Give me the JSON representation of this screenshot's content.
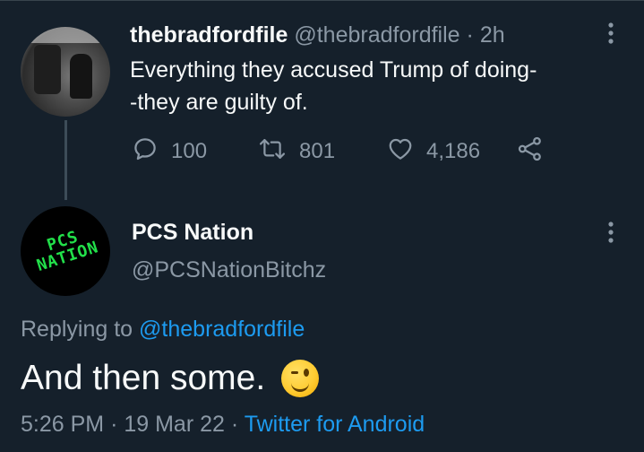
{
  "tweet1": {
    "name": "thebradfordfile",
    "handle": "@thebradfordfile",
    "separator": "·",
    "time": "2h",
    "text": "Everything they accused Trump of doing--they are guilty of.",
    "replies": "100",
    "retweets": "801",
    "likes": "4,186"
  },
  "tweet2": {
    "name": "PCS Nation",
    "handle": "@PCSNationBitchz",
    "avatar_text": "PCS NATION",
    "replying_prefix": "Replying to",
    "replying_to": "@thebradfordfile",
    "text": "And then some.",
    "time": "5:26 PM",
    "separator": "·",
    "date": "19 Mar 22",
    "source": "Twitter for Android"
  },
  "icons": [
    "reply-icon",
    "retweet-icon",
    "like-icon",
    "share-icon",
    "more-icon",
    "wink-emoji"
  ],
  "colors": {
    "background": "#15202b",
    "text": "#f7f9f9",
    "muted": "#8b98a5",
    "link": "#1d9bf0",
    "logo_green": "#22e04a"
  }
}
